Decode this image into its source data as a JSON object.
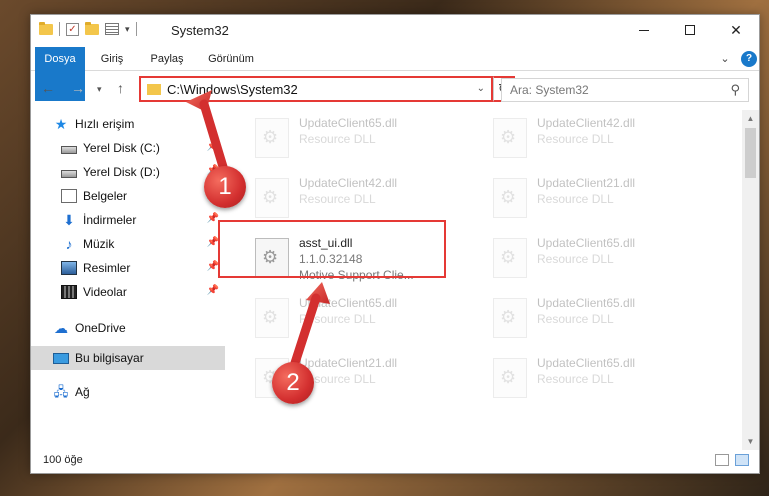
{
  "window": {
    "title": "System32"
  },
  "ribbon": {
    "tabs": [
      "Dosya",
      "Giriş",
      "Paylaş",
      "Görünüm"
    ],
    "help": "?"
  },
  "address": {
    "path": "C:\\Windows\\System32"
  },
  "search": {
    "placeholder": "Ara: System32"
  },
  "sidebar": {
    "items": [
      {
        "label": "Hızlı erişim",
        "icon": "star-icon"
      },
      {
        "label": "Yerel Disk (C:)",
        "icon": "disk-icon",
        "pinned": true
      },
      {
        "label": "Yerel Disk (D:)",
        "icon": "disk-icon",
        "pinned": true
      },
      {
        "label": "Belgeler",
        "icon": "documents-icon",
        "pinned": true
      },
      {
        "label": "İndirmeler",
        "icon": "download-icon",
        "pinned": true
      },
      {
        "label": "Müzik",
        "icon": "music-icon",
        "pinned": true
      },
      {
        "label": "Resimler",
        "icon": "pictures-icon",
        "pinned": true
      },
      {
        "label": "Videolar",
        "icon": "videos-icon",
        "pinned": true
      },
      {
        "label": "OneDrive",
        "icon": "cloud-icon"
      },
      {
        "label": "Bu bilgisayar",
        "icon": "computer-icon",
        "selected": true
      },
      {
        "label": "Ağ",
        "icon": "network-icon"
      }
    ]
  },
  "files": {
    "left": [
      {
        "name": "UpdateClient65.dll",
        "desc": "Resource DLL"
      },
      {
        "name": "UpdateClient42.dll",
        "desc": "Resource DLL"
      },
      {
        "name": "asst_ui.dll",
        "version": "1.1.0.32148",
        "company": "Motive Support Clie..."
      },
      {
        "name": "UpdateClient65.dll",
        "desc": "Resource DLL"
      },
      {
        "name": "UpdateClient21.dll",
        "desc": "Resource DLL"
      }
    ],
    "right": [
      {
        "name": "UpdateClient42.dll",
        "desc": "Resource DLL"
      },
      {
        "name": "UpdateClient21.dll",
        "desc": "Resource DLL"
      },
      {
        "name": "UpdateClient65.dll",
        "desc": "Resource DLL"
      },
      {
        "name": "UpdateClient65.dll",
        "desc": "Resource DLL"
      },
      {
        "name": "UpdateClient65.dll",
        "desc": "Resource DLL"
      }
    ]
  },
  "status": {
    "count": "100 öğe"
  },
  "callouts": {
    "one": "1",
    "two": "2"
  },
  "colors": {
    "accent": "#1979ca",
    "highlight": "#e53935"
  }
}
